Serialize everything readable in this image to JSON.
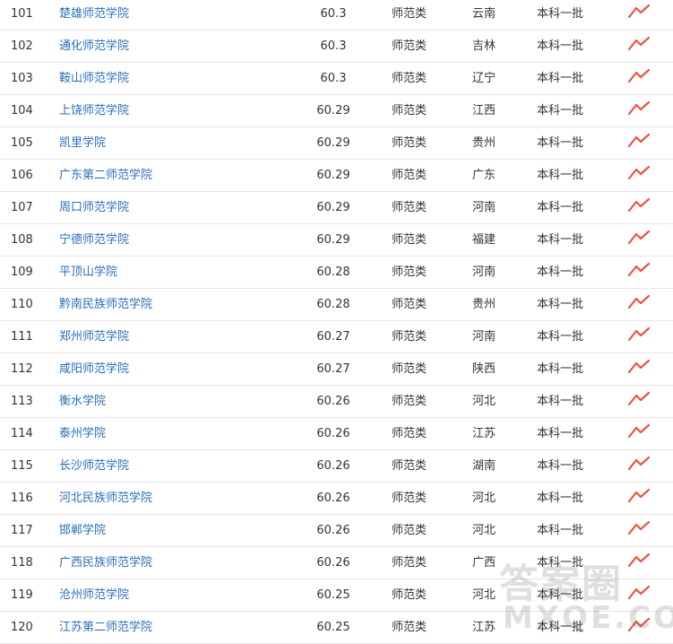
{
  "table": {
    "rows": [
      {
        "rank": "101",
        "name": "楚雄师范学院",
        "score": "60.3",
        "type": "师范类",
        "province": "云南",
        "batch": "本科一批"
      },
      {
        "rank": "102",
        "name": "通化师范学院",
        "score": "60.3",
        "type": "师范类",
        "province": "吉林",
        "batch": "本科一批"
      },
      {
        "rank": "103",
        "name": "鞍山师范学院",
        "score": "60.3",
        "type": "师范类",
        "province": "辽宁",
        "batch": "本科一批"
      },
      {
        "rank": "104",
        "name": "上饶师范学院",
        "score": "60.29",
        "type": "师范类",
        "province": "江西",
        "batch": "本科一批"
      },
      {
        "rank": "105",
        "name": "凯里学院",
        "score": "60.29",
        "type": "师范类",
        "province": "贵州",
        "batch": "本科一批"
      },
      {
        "rank": "106",
        "name": "广东第二师范学院",
        "score": "60.29",
        "type": "师范类",
        "province": "广东",
        "batch": "本科一批"
      },
      {
        "rank": "107",
        "name": "周口师范学院",
        "score": "60.29",
        "type": "师范类",
        "province": "河南",
        "batch": "本科一批"
      },
      {
        "rank": "108",
        "name": "宁德师范学院",
        "score": "60.29",
        "type": "师范类",
        "province": "福建",
        "batch": "本科一批"
      },
      {
        "rank": "109",
        "name": "平顶山学院",
        "score": "60.28",
        "type": "师范类",
        "province": "河南",
        "batch": "本科一批"
      },
      {
        "rank": "110",
        "name": "黔南民族师范学院",
        "score": "60.28",
        "type": "师范类",
        "province": "贵州",
        "batch": "本科一批"
      },
      {
        "rank": "111",
        "name": "郑州师范学院",
        "score": "60.27",
        "type": "师范类",
        "province": "河南",
        "batch": "本科一批"
      },
      {
        "rank": "112",
        "name": "咸阳师范学院",
        "score": "60.27",
        "type": "师范类",
        "province": "陕西",
        "batch": "本科一批"
      },
      {
        "rank": "113",
        "name": "衡水学院",
        "score": "60.26",
        "type": "师范类",
        "province": "河北",
        "batch": "本科一批"
      },
      {
        "rank": "114",
        "name": "泰州学院",
        "score": "60.26",
        "type": "师范类",
        "province": "江苏",
        "batch": "本科一批"
      },
      {
        "rank": "115",
        "name": "长沙师范学院",
        "score": "60.26",
        "type": "师范类",
        "province": "湖南",
        "batch": "本科一批"
      },
      {
        "rank": "116",
        "name": "河北民族师范学院",
        "score": "60.26",
        "type": "师范类",
        "province": "河北",
        "batch": "本科一批"
      },
      {
        "rank": "117",
        "name": "邯郸学院",
        "score": "60.26",
        "type": "师范类",
        "province": "河北",
        "batch": "本科一批"
      },
      {
        "rank": "118",
        "name": "广西民族师范学院",
        "score": "60.26",
        "type": "师范类",
        "province": "广西",
        "batch": "本科一批"
      },
      {
        "rank": "119",
        "name": "沧州师范学院",
        "score": "60.25",
        "type": "师范类",
        "province": "河北",
        "batch": "本科一批"
      },
      {
        "rank": "120",
        "name": "江苏第二师范学院",
        "score": "60.25",
        "type": "师范类",
        "province": "江苏",
        "batch": "本科一批"
      }
    ],
    "trend_icon": "trend-line-icon"
  },
  "colors": {
    "link": "#2a6ebb",
    "trend": "#e8553e",
    "border": "#e6e6e6",
    "text": "#333333"
  },
  "watermark": {
    "line1": "答案圈",
    "line2": "MXQE.COM"
  }
}
